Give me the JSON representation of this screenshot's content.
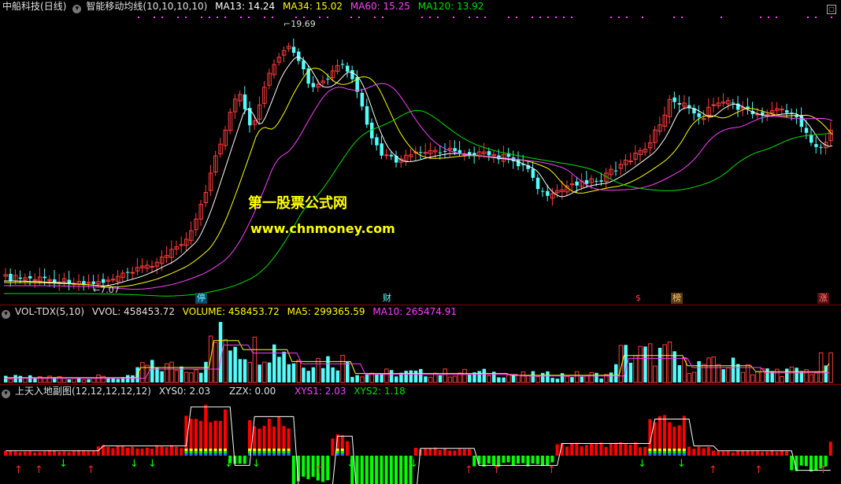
{
  "main": {
    "stock": "中船科技",
    "period": "(日线)",
    "indicator": "智能移动均线(10,10,10,10)",
    "ma13": "MA13: 14.24",
    "ma34": "MA34: 15.02",
    "ma60": "MA60: 15.25",
    "ma120": "MA120: 13.92",
    "high_label": "19.69",
    "low_label": "7.07",
    "watermark_cn": "第一股票公式网",
    "watermark_url": "www.chnmoney.com",
    "tags": [
      "停",
      "财",
      "$",
      "榜",
      "涨"
    ]
  },
  "volume": {
    "name": "VOL-TDX(5,10)",
    "vvol": "VVOL: 458453.72",
    "volume": "VOLUME: 458453.72",
    "ma5": "MA5: 299365.59",
    "ma10": "MA10: 265474.91"
  },
  "sub": {
    "name": "上天入地副图(12,12,12,12,12)",
    "xys0": "XYS0: 2.03",
    "zzx": "ZZX: 0.00",
    "xys1": "XYS1: 2.03",
    "xys2": "XYS2: 1.18"
  },
  "colors": {
    "up": "#ff3c3c",
    "down": "#54fcfc",
    "ma13": "#ffffff",
    "ma34": "#ffff00",
    "ma60": "#ff40ff",
    "ma120": "#00e000",
    "sub_pos": "#ff0000",
    "sub_neg": "#00ff00"
  }
}
